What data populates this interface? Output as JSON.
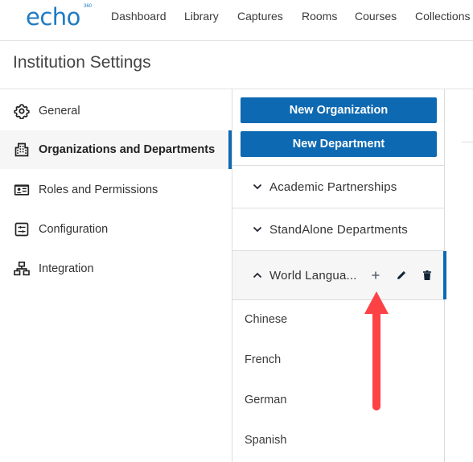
{
  "brand": {
    "name": "echo",
    "badge": "360",
    "color": "#1f7ac2"
  },
  "topnav": {
    "items": [
      {
        "label": "Dashboard"
      },
      {
        "label": "Library"
      },
      {
        "label": "Captures"
      },
      {
        "label": "Rooms"
      },
      {
        "label": "Courses"
      },
      {
        "label": "Collections"
      }
    ]
  },
  "page": {
    "title": "Institution Settings"
  },
  "sidebar": {
    "items": [
      {
        "label": "General",
        "icon": "gear-icon"
      },
      {
        "label": "Organizations and Departments",
        "icon": "building-icon",
        "active": true
      },
      {
        "label": "Roles and Permissions",
        "icon": "id-card-icon"
      },
      {
        "label": "Configuration",
        "icon": "sliders-icon"
      },
      {
        "label": "Integration",
        "icon": "network-icon"
      }
    ]
  },
  "actions": {
    "new_organization": "New Organization",
    "new_department": "New Department"
  },
  "tree": {
    "organizations": [
      {
        "label": "Academic Partnerships",
        "expanded": false
      },
      {
        "label": "StandAlone Departments",
        "expanded": false
      },
      {
        "label": "World Langua...",
        "expanded": true,
        "row_actions": [
          "add-icon",
          "edit-icon",
          "delete-icon"
        ],
        "children": [
          {
            "label": "Chinese"
          },
          {
            "label": "French"
          },
          {
            "label": "German"
          },
          {
            "label": "Spanish"
          }
        ]
      }
    ]
  },
  "annotation": {
    "type": "arrow",
    "color": "#fd4246",
    "points_to": "add-department-button"
  },
  "colors": {
    "accent": "#0d69b2",
    "active_bg": "#f6f6f6"
  }
}
